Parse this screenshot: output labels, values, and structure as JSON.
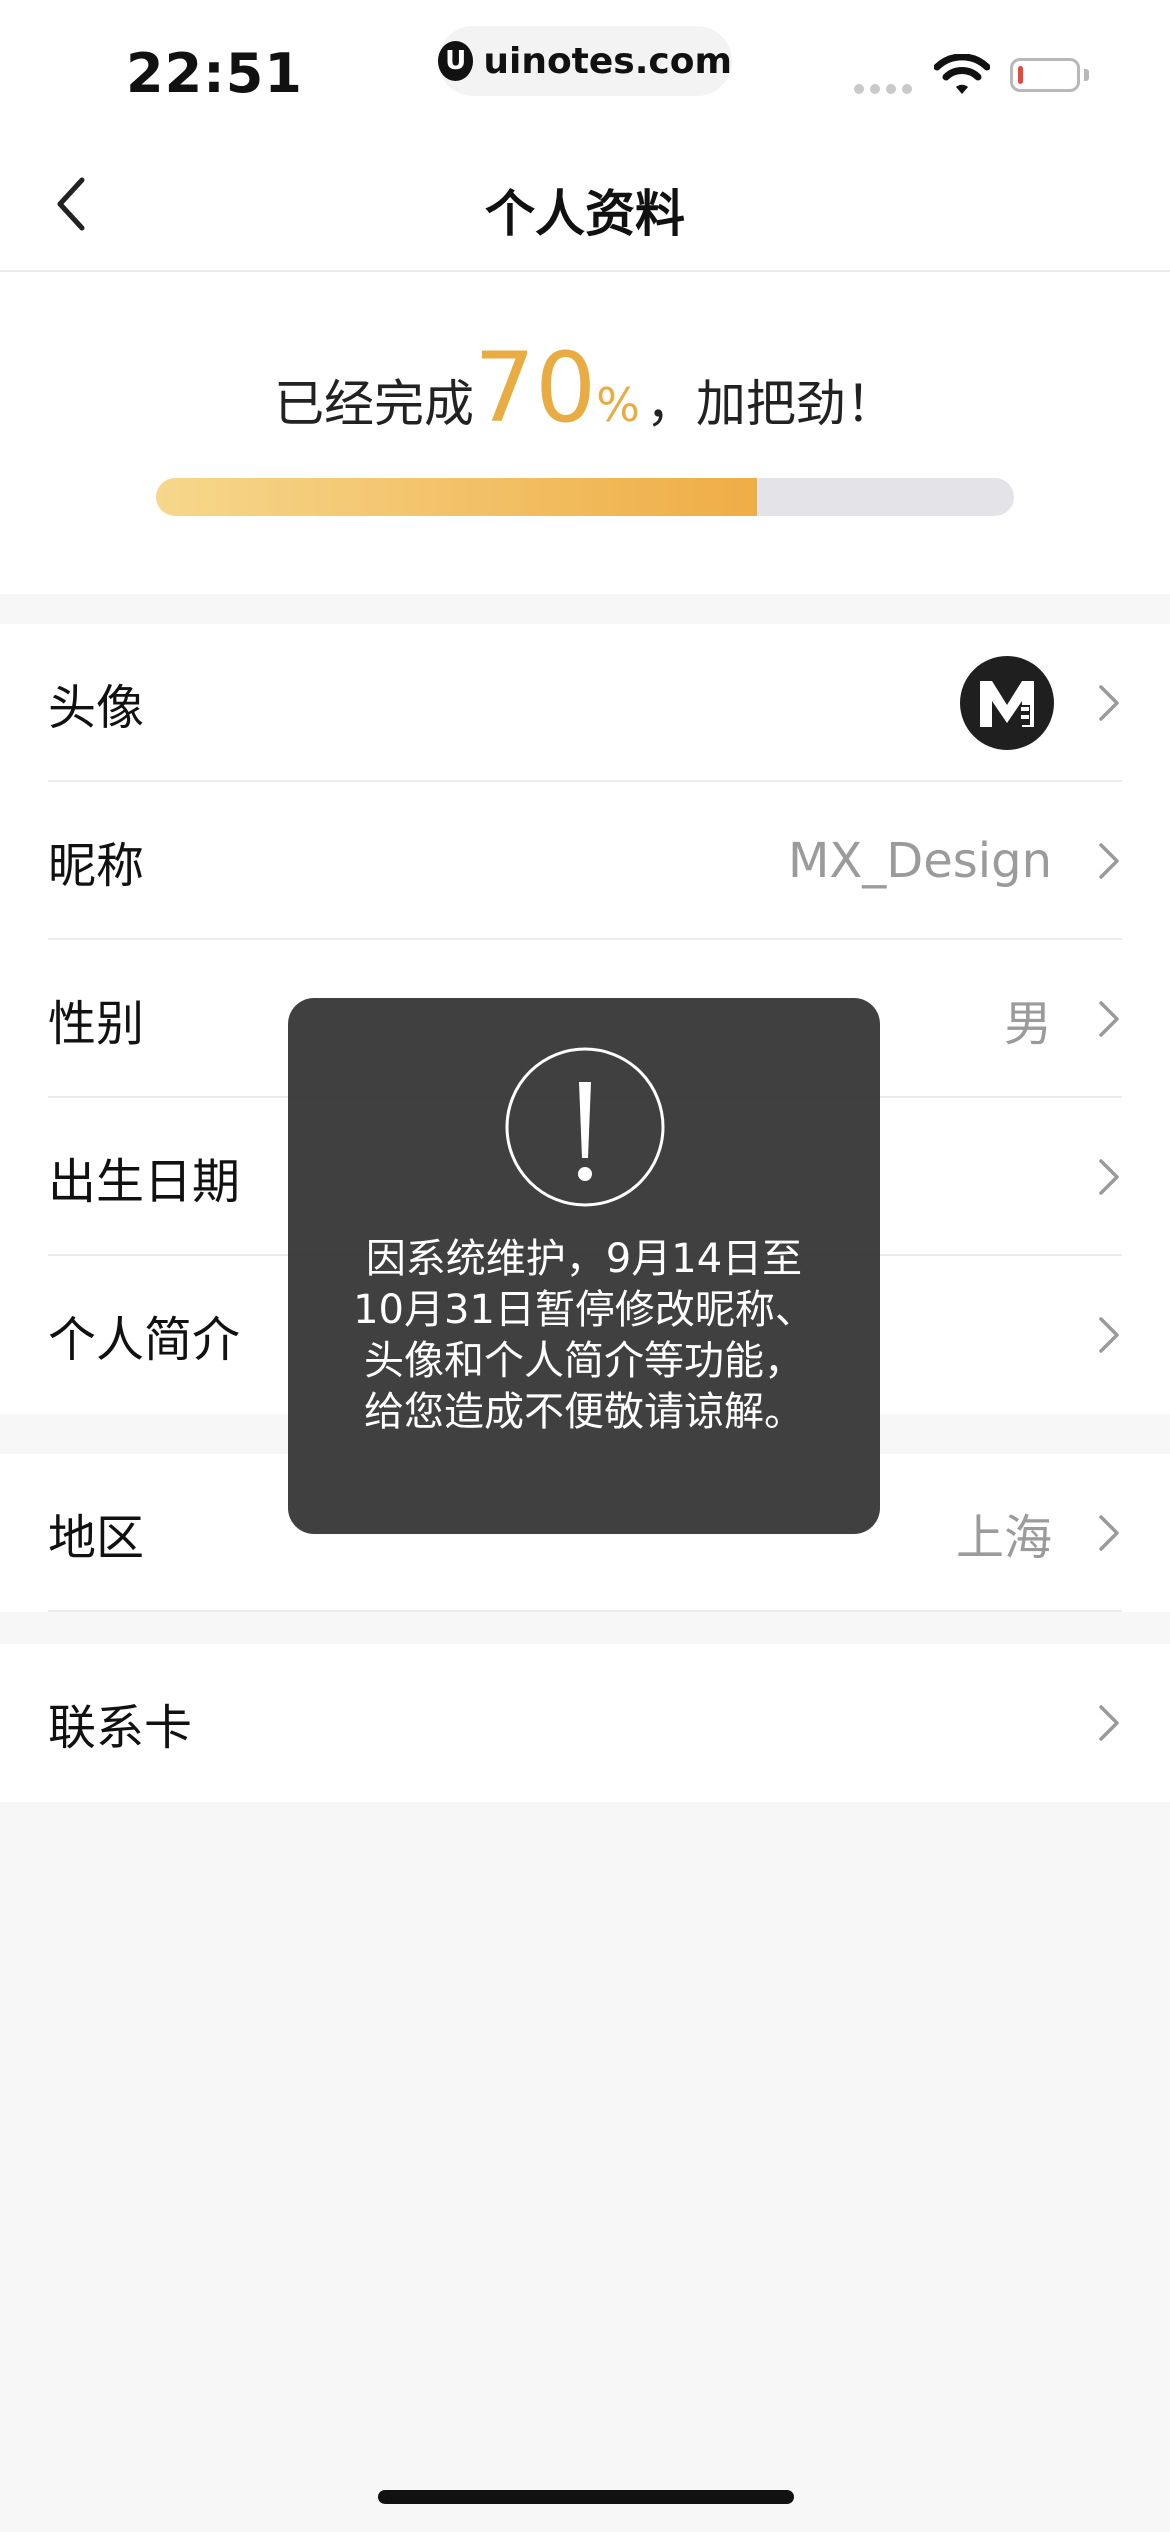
{
  "status_bar": {
    "time": "22:51",
    "watermark_logo": "U",
    "watermark": "uinotes.com",
    "icons": [
      "cellular-signal-icon",
      "wifi-icon",
      "battery-low-icon"
    ]
  },
  "nav": {
    "title": "个人资料",
    "back_icon": "chevron-left-icon"
  },
  "progress": {
    "prefix": "已经完成",
    "percent_number": "70",
    "percent_sign": "%",
    "suffix": "，加把劲！",
    "fill_fraction": 0.7,
    "colors": {
      "accent": "#e8ac43",
      "fill_start": "#f6d78c",
      "fill_end": "#efad45",
      "track": "#e4e4e8"
    }
  },
  "profile": {
    "avatar": {
      "label": "头像",
      "image_icon": "user-avatar-m-logo"
    },
    "nickname": {
      "label": "昵称",
      "value": "MX_Design"
    },
    "gender": {
      "label": "性别",
      "value": "男"
    },
    "birthday": {
      "label": "出生日期"
    },
    "bio": {
      "label": "个人简介"
    }
  },
  "location": {
    "region": {
      "label": "地区",
      "value": "上海"
    }
  },
  "contact": {
    "card": {
      "label": "联系卡"
    }
  },
  "toast": {
    "icon": "exclamation-circle-icon",
    "message": "因系统维护，9月14日至10月31日暂停修改昵称、头像和个人简介等功能，给您造成不便敬请谅解。"
  }
}
